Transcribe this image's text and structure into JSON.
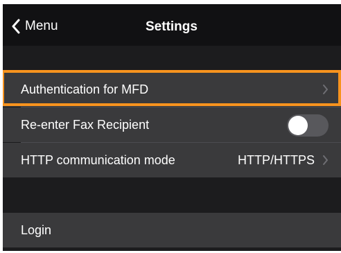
{
  "navbar": {
    "back_label": "Menu",
    "title": "Settings"
  },
  "settings": {
    "auth_label": "Authentication for MFD",
    "fax_label": "Re-enter Fax Recipient",
    "fax_toggle_on": false,
    "http_label": "HTTP communication mode",
    "http_value": "HTTP/HTTPS",
    "login_label": "Login"
  },
  "colors": {
    "highlight": "#f7931e",
    "row_background": "#3a3a3c",
    "screen_background": "#1c1c1e"
  }
}
